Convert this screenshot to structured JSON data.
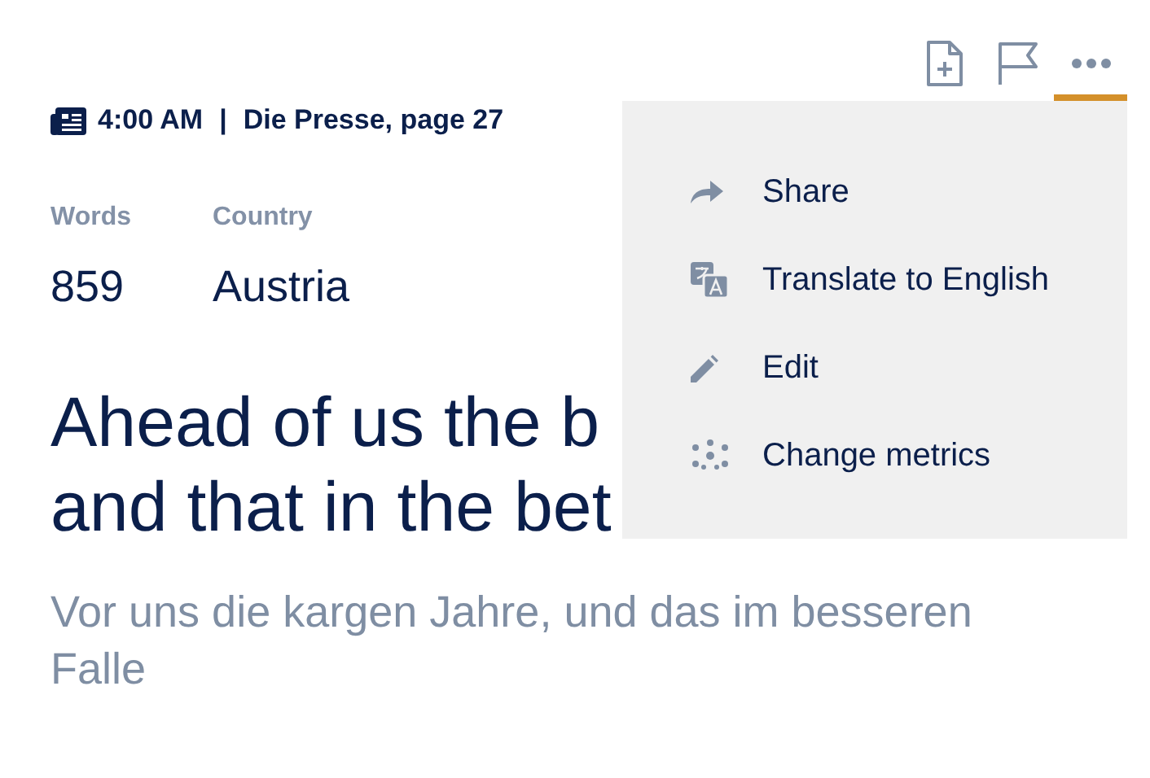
{
  "toolbar": [
    {
      "kind": "add-document",
      "selected": false
    },
    {
      "kind": "flag",
      "selected": false
    },
    {
      "kind": "more",
      "selected": true
    }
  ],
  "meta": {
    "time": "4:00 AM",
    "separator": "|",
    "source": "Die Presse, page 27"
  },
  "stats": [
    {
      "label": "Words",
      "value": "859"
    },
    {
      "label": "Country",
      "value": "Austria"
    }
  ],
  "headline_lines": [
    "Ahead of us the b",
    "and that in the bet"
  ],
  "subtitle": "Vor uns die kargen Jahre, und das im besseren Falle",
  "menu": {
    "items": [
      {
        "kind": "share",
        "label": "Share"
      },
      {
        "kind": "translate",
        "label": "Translate to English"
      },
      {
        "kind": "edit",
        "label": "Edit"
      },
      {
        "kind": "metrics",
        "label": "Change metrics"
      }
    ]
  }
}
